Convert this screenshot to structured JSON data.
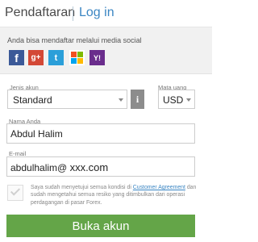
{
  "header": {
    "register_tab": "Pendaftaran",
    "login_tab": "Log in"
  },
  "social": {
    "caption": "Anda bisa mendaftar melalui media social",
    "icons": [
      {
        "name": "facebook-icon",
        "glyph": "f",
        "color": "#3b5998"
      },
      {
        "name": "google-plus-icon",
        "glyph": "g+",
        "color": "#d34836"
      },
      {
        "name": "twitter-icon",
        "glyph": "t",
        "color": "#2b9fd9"
      },
      {
        "name": "microsoft-icon",
        "glyph": "",
        "color": "#ffffff"
      },
      {
        "name": "yahoo-icon",
        "glyph": "Y!",
        "color": "#6a2d8c"
      }
    ]
  },
  "form": {
    "account_type_label": "Jenis akun",
    "account_type_value": "Standard",
    "info_glyph": "i",
    "currency_label": "Mata uang",
    "currency_value": "USD",
    "name_label": "Nama Anda",
    "name_value": "Abdul Halim",
    "email_label": "E-mail",
    "email_value": "abdulhalim@",
    "email_domain": "xxx.com",
    "terms_before": "Saya sudah menyetujui semua kondisi di ",
    "terms_link": "Customer Agreement",
    "terms_after": " dan sudah mengetahui semua resiko yang ditimbulkan dari operasi perdagangan di pasar Forex.",
    "submit_label": "Buka akun"
  },
  "colors": {
    "accent_link": "#3b86c3",
    "submit_green": "#64a548",
    "info_gray": "#8c8c8c"
  }
}
